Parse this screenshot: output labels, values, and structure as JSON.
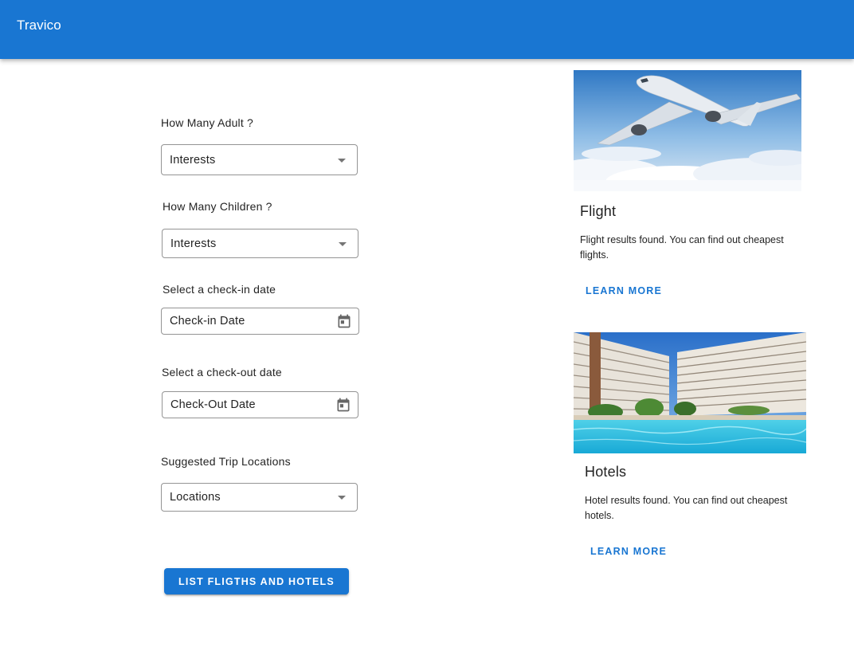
{
  "app": {
    "title": "Travico"
  },
  "form": {
    "adults": {
      "label": "How Many Adult ?",
      "value": "Interests"
    },
    "children": {
      "label": "How Many Children ?",
      "value": "Interests"
    },
    "checkin": {
      "label": "Select a check-in date",
      "placeholder": "Check-in Date"
    },
    "checkout": {
      "label": "Select a check-out date",
      "placeholder": "Check-Out Date"
    },
    "locations": {
      "label": "Suggested Trip Locations",
      "value": "Locations"
    },
    "submit_label": "LIST FLIGTHS AND HOTELS"
  },
  "cards": {
    "flight": {
      "title": "Flight",
      "text": "Flight results found. You can find out cheapest flights.",
      "action": "LEARN MORE",
      "image": "airplane-in-sky"
    },
    "hotels": {
      "title": "Hotels",
      "text": "Hotel results found. You can find out cheapest hotels.",
      "action": "LEARN MORE",
      "image": "hotel-with-pool"
    }
  },
  "colors": {
    "primary": "#1976d2",
    "appbar": "#1976d2"
  },
  "icons": {
    "select": "arrow-drop-down-icon",
    "date": "calendar-icon"
  }
}
